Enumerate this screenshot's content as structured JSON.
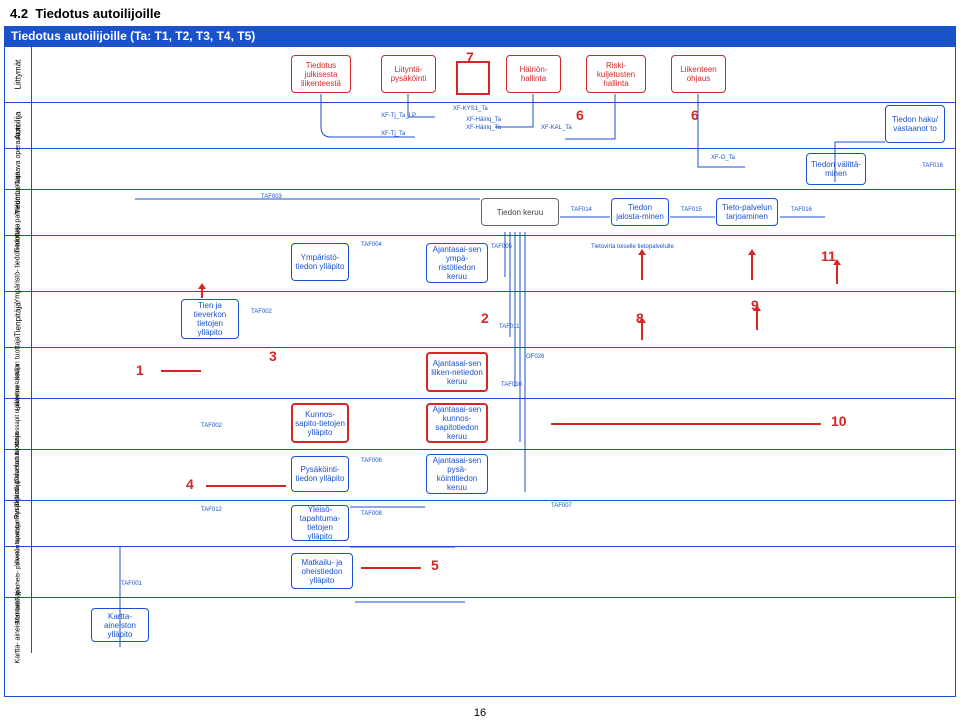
{
  "section_number": "4.2",
  "section_title": "Tiedotus autoilijoille",
  "pool_title": "Tiedotus autoilijoille (Ta: T1, T2, T3, T4, T5)",
  "page_number": "16",
  "lanes": [
    {
      "id": "liittymat",
      "label": "Liittymät"
    },
    {
      "id": "autoilija",
      "label": "Autoilija"
    },
    {
      "id": "tiedotuskanava",
      "label": "Tiedotus-\nkanava\noperaattori"
    },
    {
      "id": "tiedotuspalvelu",
      "label": "Tiedotus-\npalvelun\ntuottaja"
    },
    {
      "id": "ymparisto",
      "label": "Ympäristö-\ntiedon\ntuottaja"
    },
    {
      "id": "tienpitaja",
      "label": "Tienpitäjä"
    },
    {
      "id": "liikennetieto",
      "label": "Liikenne-\ntiedon\ntuottaja"
    },
    {
      "id": "kunnossapito",
      "label": "(Tien/\nkadun)\nkunnossapit\no-palvelun\ntuottaja"
    },
    {
      "id": "pysakointi",
      "label": "Pysäköinti-\npalvelun\ntuottaja"
    },
    {
      "id": "yleisotapahtuma",
      "label": "Yleisö-\ntapahtumien\njärjestäjä"
    },
    {
      "id": "matkailu",
      "label": "Matkailu- ja\noheis-\npalvelun\ntuottaja"
    },
    {
      "id": "kartta",
      "label": "Kartta-\naineiston\ntuottaja"
    }
  ],
  "nodes": {
    "tiedotus_julk": "Tiedotus julkisesta liikenteestä",
    "liitynta": "Liityntä-pysäköinti",
    "hairion": "Häiriön-hallinta",
    "riski": "Riski-kuljetusten hallinta",
    "liikenteen": "Liikenteen ohjaus",
    "tiedon_haku": "Tiedon haku/ vastaanot to",
    "tiedon_valitt": "Tiedon välittä-minen",
    "tiedon_keruu": "Tiedon keruu",
    "tiedon_jalost": "Tiedon jalosta-minen",
    "tietopalvelun": "Tieto-palvelun tarjoaminen",
    "ymparisto_yllapito": "Ympäristö-tiedon ylläpito",
    "ajantasai_ymp": "Ajantasai-sen ympä-ristötiedon keruu",
    "tien_tietojen": "Tien ja tieverkon tietojen ylläpito",
    "ajantasai_liik": "Ajantasai-sen liiken-netiedon keruu",
    "kunnos_yllapito": "Kunnos-sapito-tietojen ylläpito",
    "ajantasai_kunnos": "Ajantasai-sen kunnos-sapitotiedon keruu",
    "pysakointi_yllapito": "Pysäköinti-tiedon ylläpito",
    "ajantasai_pysak": "Ajantasai-sen pysä-köintitiedon keruu",
    "yleiso_yllapito": "Yleisö-tapahtuma-tietojen ylläpito",
    "matkailu_yllapito": "Matkailu- ja oheistiedon ylläpito",
    "kartta_yllapito": "Kartta-aineiston ylläpito"
  },
  "labels": {
    "xf_tj_ta_lp": "XF-Tj_Ta_LP",
    "xf_tj_ta": "XF-Tj_Ta",
    "xf_kys1_ta": "XF-KYS1_Ta",
    "xf_hairq_ta": "XF-Häiriq_Ta",
    "xf_hairq_ta2": "XF-Häiriq_Ta",
    "xf_kal_ta": "XF-KAL_Ta",
    "xf_o_ta": "XF-O_Ta",
    "taf001": "TAF001",
    "taf002": "TAF002",
    "taf002b": "TAF002",
    "taf003": "TAF003",
    "taf004": "TAF004",
    "taf005": "TAF005",
    "taf006": "TAF006",
    "taf007": "TAF007",
    "taf008": "TAF008",
    "taf010": "TAF010",
    "taf011": "TAF011",
    "taf012": "TAF012",
    "taf014": "TAF014",
    "taf015": "TAF015",
    "taf016": "TAF016",
    "taf016b": "TAF016",
    "of026": "OF026",
    "tietovirta": "Tietovirta toiselle tietopalvelulle"
  },
  "markers": {
    "m1": "1",
    "m2": "2",
    "m3": "3",
    "m4": "4",
    "m5": "5",
    "m6a": "6",
    "m6b": "6",
    "m7": "7",
    "m8": "8",
    "m9": "9",
    "m10": "10",
    "m11": "11"
  }
}
